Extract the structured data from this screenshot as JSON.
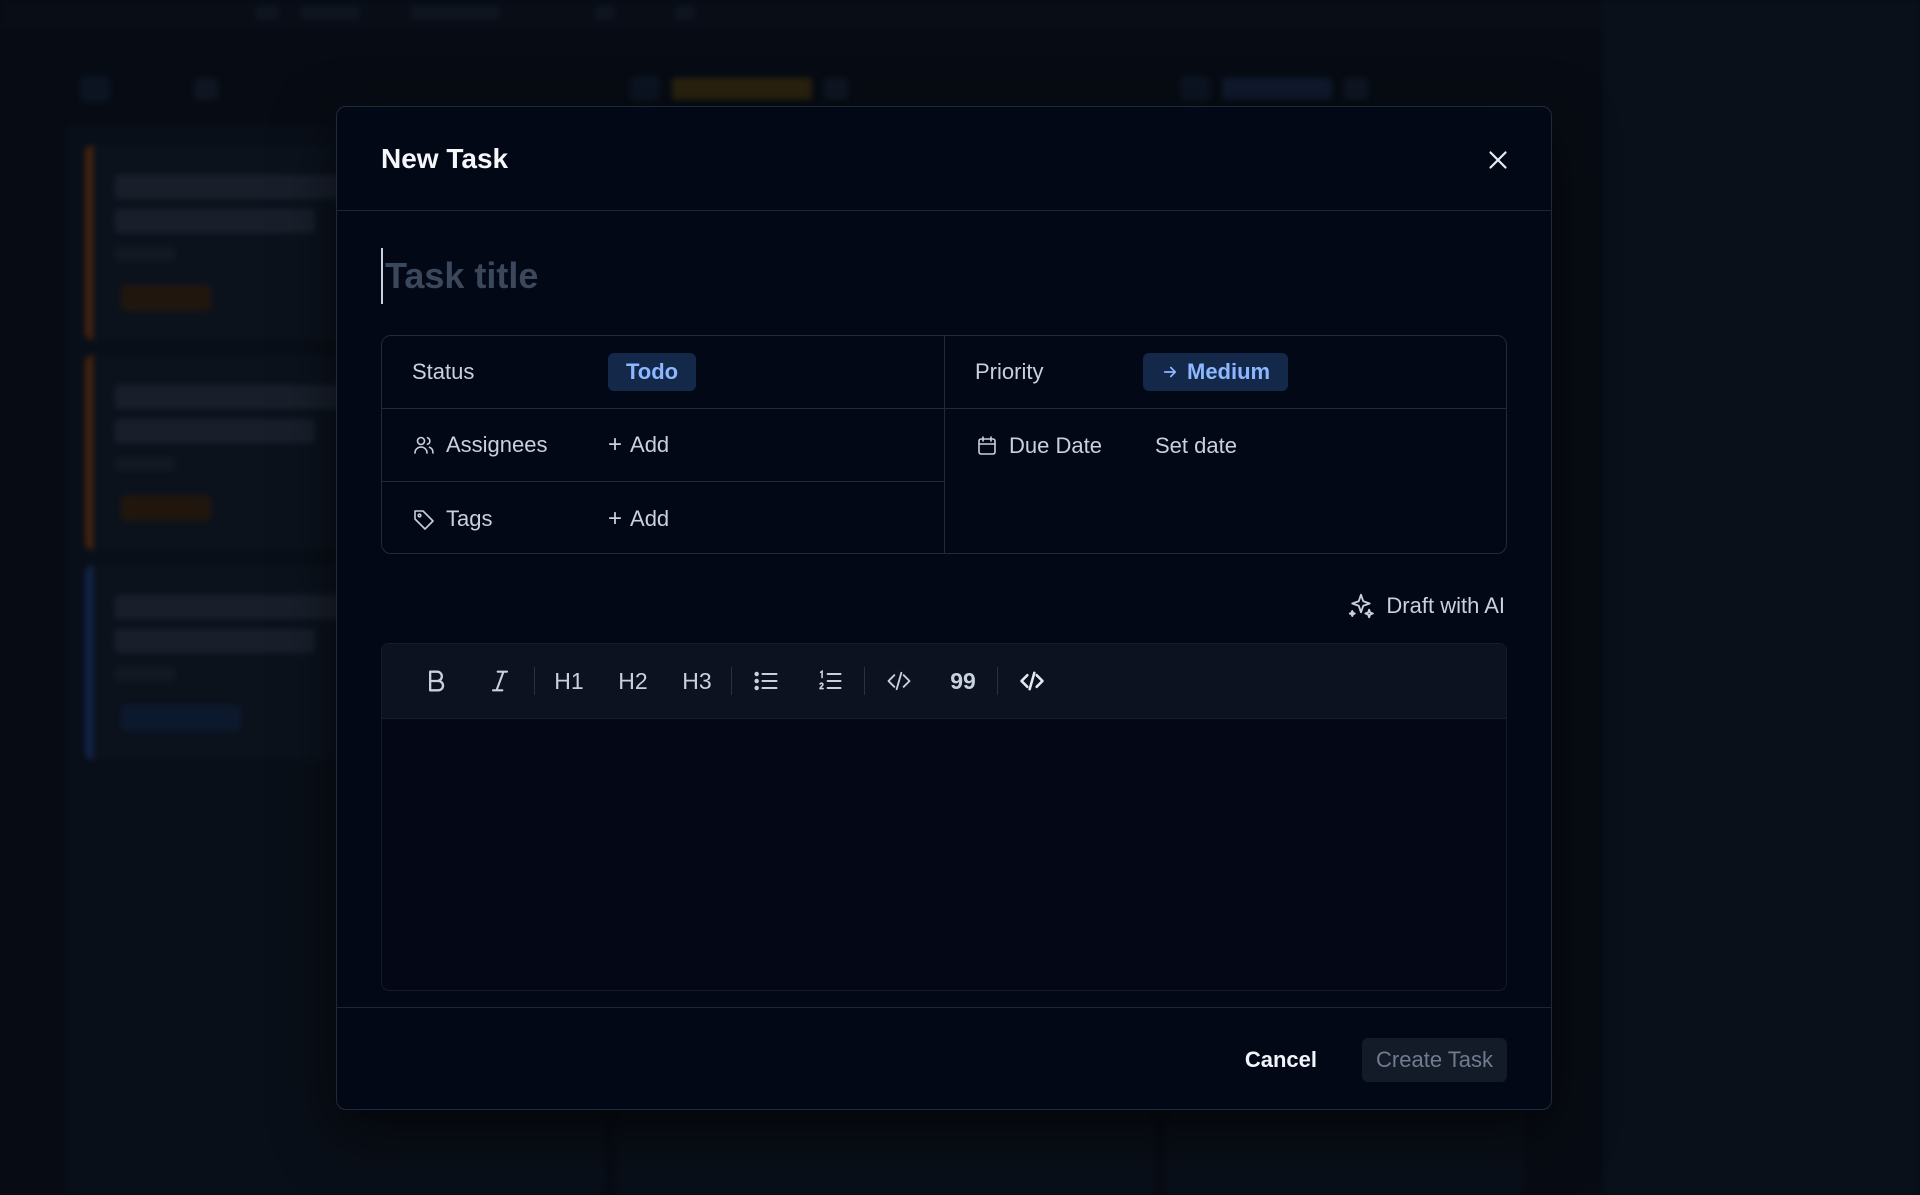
{
  "modal": {
    "title": "New Task",
    "title_placeholder": "Task title"
  },
  "properties": {
    "status": {
      "label": "Status",
      "value": "Todo"
    },
    "priority": {
      "label": "Priority",
      "value": "Medium"
    },
    "assignees": {
      "label": "Assignees",
      "action": "Add"
    },
    "due_date": {
      "label": "Due Date",
      "value": "Set date"
    },
    "tags": {
      "label": "Tags",
      "action": "Add"
    }
  },
  "ai": {
    "label": "Draft with AI"
  },
  "toolbar": {
    "h1": "H1",
    "h2": "H2",
    "h3": "H3",
    "quote": "99"
  },
  "footer": {
    "cancel": "Cancel",
    "create": "Create Task"
  },
  "colors": {
    "modal_bg": "#030817",
    "pill_bg": "#14284a",
    "pill_text": "#8db8ff",
    "accent_orange": "#7a3a10",
    "accent_blue": "#1c3a7a"
  },
  "icons": [
    "close-icon",
    "users-icon",
    "calendar-icon",
    "tag-icon",
    "sparkle-icon",
    "arrow-right-icon",
    "bold-icon",
    "italic-icon",
    "bullet-list-icon",
    "ordered-list-icon",
    "code-icon",
    "code-block-icon"
  ]
}
